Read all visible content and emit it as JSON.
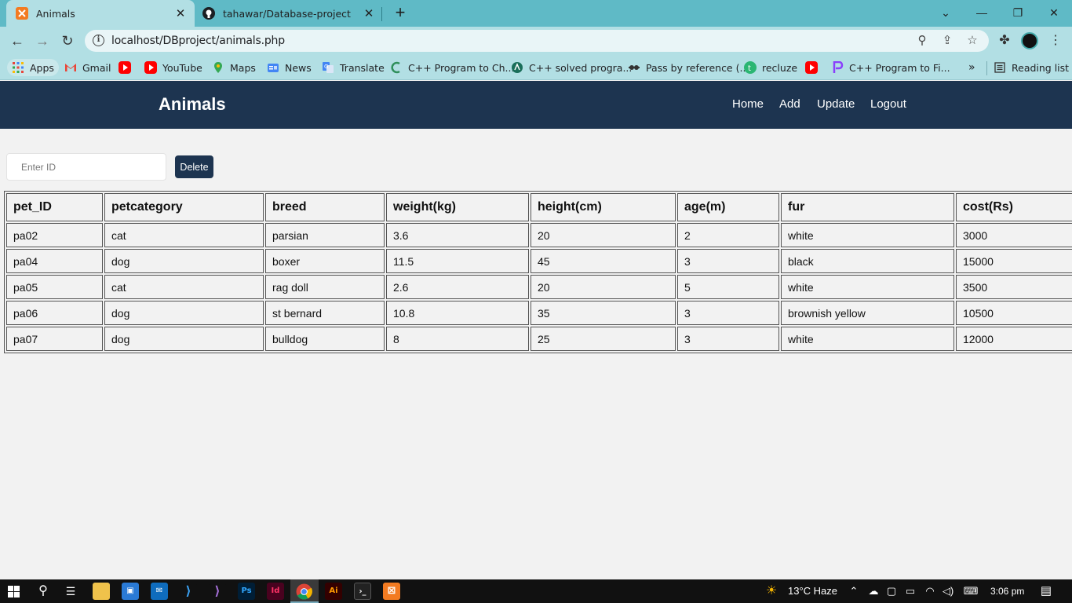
{
  "browser": {
    "tabs": [
      {
        "title": "Animals",
        "active": true
      },
      {
        "title": "tahawar/Database-project",
        "active": false
      }
    ],
    "new_tab": "+",
    "url": "localhost/DBproject/animals.php",
    "bookmarks": [
      {
        "label": "Apps",
        "icon": "apps-grid-icon"
      },
      {
        "label": "Gmail",
        "icon": "gmail-icon"
      },
      {
        "label": "",
        "icon": "youtube-icon"
      },
      {
        "label": "YouTube",
        "icon": "youtube-icon"
      },
      {
        "label": "Maps",
        "icon": "maps-pin-icon"
      },
      {
        "label": "News",
        "icon": "google-news-icon"
      },
      {
        "label": "Translate",
        "icon": "google-translate-icon"
      },
      {
        "label": "C++ Program to Ch...",
        "icon": "cpp-site-icon"
      },
      {
        "label": "C++ solved progra...",
        "icon": "cpp-solved-icon"
      },
      {
        "label": "Pass by reference (...",
        "icon": "pass-by-reference-icon"
      },
      {
        "label": "recluze",
        "icon": "recluze-icon"
      },
      {
        "label": "",
        "icon": "youtube-icon"
      },
      {
        "label": "C++ Program to Fi...",
        "icon": "cpp-program-icon"
      }
    ],
    "overflow": "»",
    "reading_list": "Reading list"
  },
  "site": {
    "title": "Animals",
    "nav": [
      "Home",
      "Add",
      "Update",
      "Logout"
    ]
  },
  "delete_form": {
    "placeholder": "Enter ID",
    "button_label": "Delete"
  },
  "table": {
    "columns": [
      "pet_ID",
      "petcategory",
      "breed",
      "weight(kg)",
      "height(cm)",
      "age(m)",
      "fur",
      "cost(Rs)"
    ],
    "rows": [
      [
        "pa02",
        "cat",
        "parsian",
        "3.6",
        "20",
        "2",
        "white",
        "3000"
      ],
      [
        "pa04",
        "dog",
        "boxer",
        "11.5",
        "45",
        "3",
        "black",
        "15000"
      ],
      [
        "pa05",
        "cat",
        "rag doll",
        "2.6",
        "20",
        "5",
        "white",
        "3500"
      ],
      [
        "pa06",
        "dog",
        "st bernard",
        "10.8",
        "35",
        "3",
        "brownish yellow",
        "10500"
      ],
      [
        "pa07",
        "dog",
        "bulldog",
        "8",
        "25",
        "3",
        "white",
        "12000"
      ]
    ]
  },
  "taskbar": {
    "weather": "13°C  Haze",
    "time": "3:06 pm"
  },
  "colors": {
    "header_bg": "#1d3450",
    "tab_strip": "#5fbac6",
    "toolbar": "#b2dfe4",
    "page_bg": "#f2f2f2"
  }
}
